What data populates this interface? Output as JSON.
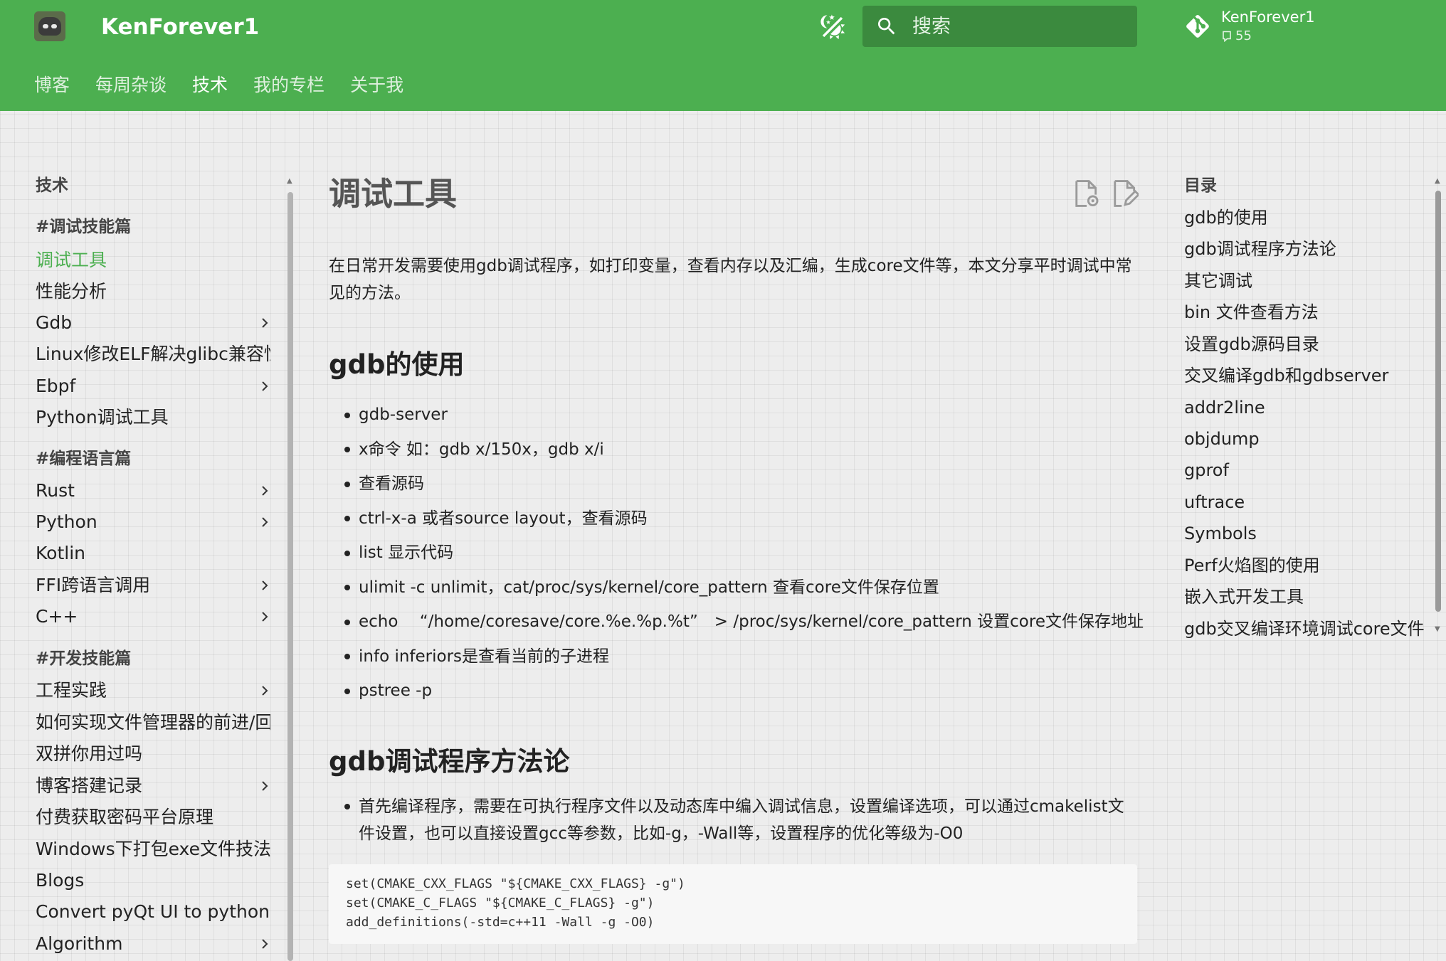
{
  "header": {
    "site_title": "KenForever1",
    "search_placeholder": "搜索",
    "repo": {
      "name": "KenForever1",
      "count": "55"
    },
    "nav": [
      {
        "label": "博客",
        "active": false
      },
      {
        "label": "每周杂谈",
        "active": false
      },
      {
        "label": "技术",
        "active": true
      },
      {
        "label": "我的专栏",
        "active": false
      },
      {
        "label": "关于我",
        "active": false
      }
    ]
  },
  "sidebar": {
    "title": "技术",
    "sections": [
      {
        "heading": "#调试技能篇"
      },
      {
        "heading": "#编程语言篇"
      },
      {
        "heading": "#开发技能篇"
      }
    ],
    "items": [
      {
        "label": "调试工具",
        "active": true,
        "expandable": false
      },
      {
        "label": "性能分析",
        "expandable": false
      },
      {
        "label": "Gdb",
        "expandable": true
      },
      {
        "label": "Linux修改ELF解决glibc兼容性...",
        "expandable": false
      },
      {
        "label": "Ebpf",
        "expandable": true
      },
      {
        "label": "Python调试工具",
        "expandable": false
      },
      {
        "label": "Rust",
        "expandable": true
      },
      {
        "label": "Python",
        "expandable": true
      },
      {
        "label": "Kotlin",
        "expandable": false
      },
      {
        "label": "FFI跨语言调用",
        "expandable": true
      },
      {
        "label": "C++",
        "expandable": true
      },
      {
        "label": "工程实践",
        "expandable": true
      },
      {
        "label": "如何实现文件管理器的前进/回...",
        "expandable": false
      },
      {
        "label": "双拼你用过吗",
        "expandable": false
      },
      {
        "label": "博客搭建记录",
        "expandable": true
      },
      {
        "label": "付费获取密码平台原理",
        "expandable": false
      },
      {
        "label": "Windows下打包exe文件技法",
        "expandable": false
      },
      {
        "label": "Blogs",
        "expandable": false
      },
      {
        "label": "Convert pyQt UI to python",
        "expandable": false
      },
      {
        "label": "Algorithm",
        "expandable": true
      }
    ]
  },
  "main": {
    "title": "调试工具",
    "intro": "在日常开发需要使用gdb调试程序，如打印变量，查看内存以及汇编，生成core文件等，本文分享平时调试中常见的方法。",
    "section1": {
      "heading": "gdb的使用",
      "bullets": [
        "gdb-server",
        "x命令 如：gdb x/150x，gdb x/i",
        "查看源码",
        "ctrl-x-a 或者source layout，查看源码",
        "list 显示代码",
        "ulimit -c unlimit，cat/proc/sys/kernel/core_pattern 查看core文件保存位置",
        "echo 　“/home/coresave/core.%e.%p.%t”　> /proc/sys/kernel/core_pattern 设置core文件保存地址",
        "info inferiors是查看当前的子进程",
        "pstree -p"
      ]
    },
    "section2": {
      "heading": "gdb调试程序方法论",
      "bullets": [
        "首先编译程序，需要在可执行程序文件以及动态库中编入调试信息，设置编译选项，可以通过cmakelist文件设置，也可以直接设置gcc等参数，比如-g，-Wall等，设置程序的优化等级为-O0"
      ],
      "code": [
        "set(CMAKE_CXX_FLAGS \"${CMAKE_CXX_FLAGS} -g\")",
        "set(CMAKE_C_FLAGS \"${CMAKE_C_FLAGS} -g\")",
        "add_definitions(-std=c++11 -Wall -g -O0)"
      ]
    }
  },
  "toc": {
    "title": "目录",
    "items": [
      "gdb的使用",
      "gdb调试程序方法论",
      "其它调试",
      "bin 文件查看方法",
      "设置gdb源码目录",
      "交叉编译gdb和gdbserver",
      "addr2line",
      "objdump",
      "gprof",
      "uftrace",
      "Symbols",
      "Perf火焰图的使用",
      "嵌入式开发工具",
      "gdb交叉编译环境调试core文件"
    ]
  },
  "colors": {
    "brand": "#4caf50",
    "active_link": "#4caf50"
  },
  "icons": [
    "avatar-logo",
    "theme-toggle-icon",
    "search-icon",
    "git-repo-icon",
    "star-icon",
    "chevron-right-icon",
    "view-source-icon",
    "edit-page-icon"
  ]
}
